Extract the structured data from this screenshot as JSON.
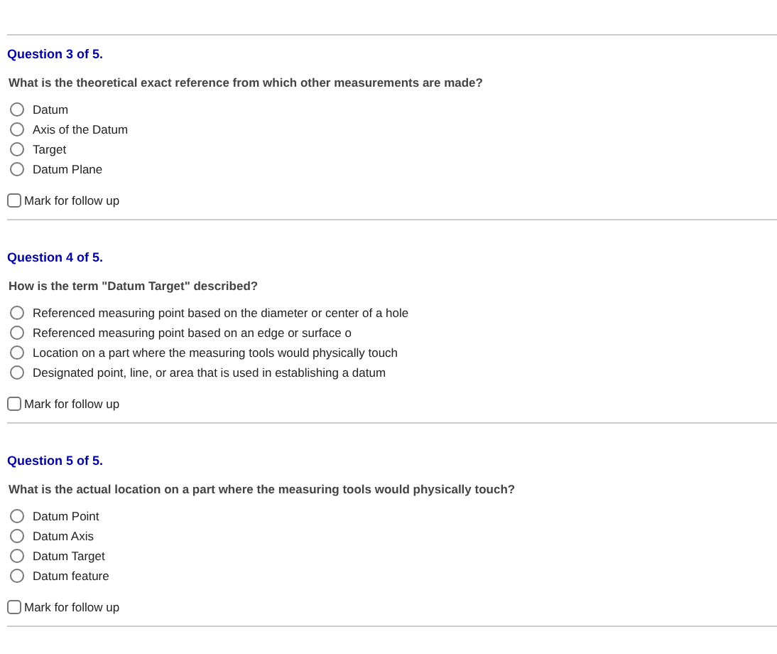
{
  "questions": [
    {
      "heading": "Question 3 of 5.",
      "prompt": "What is the theoretical exact reference from which other measurements are made?",
      "options": [
        {
          "label": "Datum",
          "selected": false
        },
        {
          "label": "Axis of the Datum",
          "selected": false
        },
        {
          "label": "Target",
          "selected": false
        },
        {
          "label": "Datum Plane",
          "selected": false
        }
      ],
      "follow_up": {
        "label": "Mark for follow up",
        "checked": false
      }
    },
    {
      "heading": "Question 4 of 5.",
      "prompt": "How is the term \"Datum Target\" described?",
      "options": [
        {
          "label": "Referenced measuring point based on the diameter or center of a hole",
          "selected": false
        },
        {
          "label": "Referenced measuring point based on an edge or surface o",
          "selected": false
        },
        {
          "label": "Location on a part where the measuring tools would physically touch",
          "selected": false
        },
        {
          "label": "Designated point, line, or area that is used in establishing a datum",
          "selected": false
        }
      ],
      "follow_up": {
        "label": "Mark for follow up",
        "checked": false
      }
    },
    {
      "heading": "Question 5 of 5.",
      "prompt": "What is the actual location on a part where the measuring tools would physically touch?",
      "options": [
        {
          "label": "Datum Point",
          "selected": false
        },
        {
          "label": "Datum Axis",
          "selected": false
        },
        {
          "label": "Datum Target",
          "selected": false
        },
        {
          "label": "Datum feature",
          "selected": false
        }
      ],
      "follow_up": {
        "label": "Mark for follow up",
        "checked": false
      }
    }
  ]
}
